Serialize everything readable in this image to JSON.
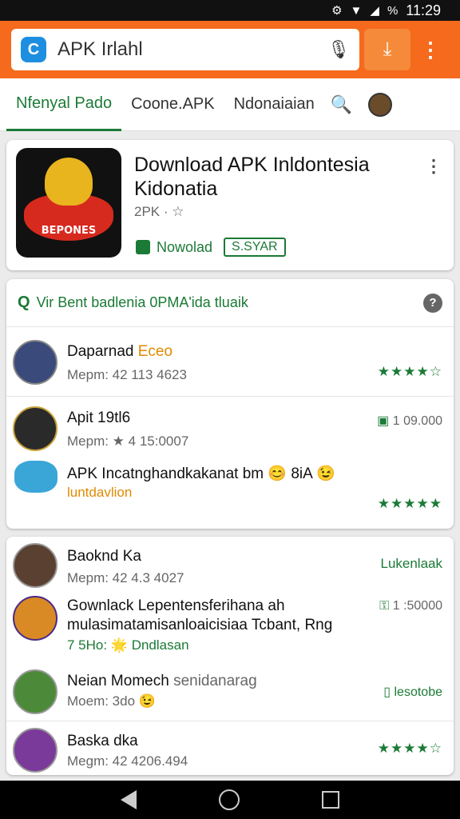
{
  "status": {
    "time": "11:29",
    "battery": "%"
  },
  "search": {
    "value": "APK Irlahl",
    "logo": "C"
  },
  "tabs": [
    "Nfenyal Pado",
    "Coone.APK",
    "Ndonaiaian"
  ],
  "hero": {
    "icon_text": "BEPONES",
    "title_line1": "Download APK Inldontesia",
    "title_line2": "Kidonatia",
    "meta": "2PK ·",
    "install_label": "Nowolad",
    "install_badge": "S.SYAR"
  },
  "list1": {
    "header": "Vir Bent badlenia 0PMA'ida tluaik",
    "items": [
      {
        "title": "Daparnad",
        "title_extra": "Eceo",
        "sub": "Mepm: 42 113 4623",
        "right": "★★★★☆"
      },
      {
        "title": "Apit 19tl6",
        "sub": "Mepm: ★ 4 15:0007",
        "right": "1 09.000"
      },
      {
        "title": "APK Incatnghandkakanat bm 😊 8iA 😉",
        "sub": "luntdavlion",
        "right": "★★★★★"
      }
    ]
  },
  "list2": {
    "items": [
      {
        "title": "Baoknd Ka",
        "sub": "Mepm: 42 4.3 4027",
        "right": "Lukenlaak"
      },
      {
        "title": "Gownlack Lepentensferihana ah",
        "title2": "mulasimatamisanloaicisiaa Tcbant, Rng",
        "sub": "7 5Ho: 🌟 Dndlasan",
        "right": "1 :50000"
      },
      {
        "title": "Neian Momech",
        "title_extra": "senidanarag",
        "sub": "Moem: 3do 😉",
        "right": "lesotobe"
      },
      {
        "title": "Baska dka",
        "sub": "Megm: 42 4206.494",
        "right": "★★★★☆"
      }
    ]
  },
  "colors": {
    "accent": "#f56a1d",
    "green": "#1b7a36"
  }
}
